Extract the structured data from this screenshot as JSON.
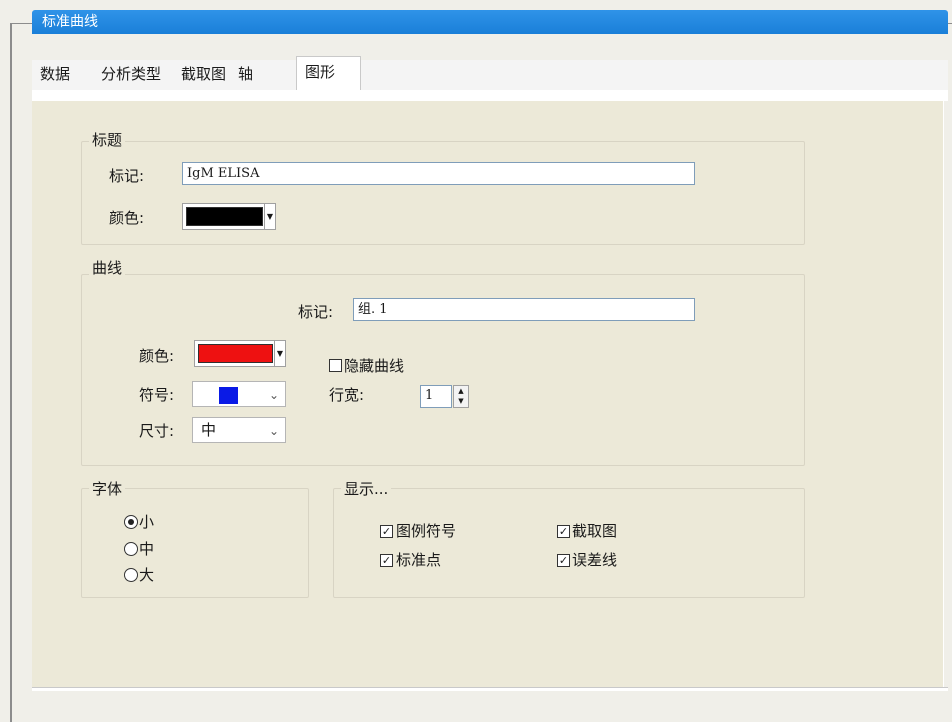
{
  "window": {
    "title": "标准曲线"
  },
  "tabs": [
    {
      "label": "数据"
    },
    {
      "label": "分析类型"
    },
    {
      "label": "截取图"
    },
    {
      "label": "轴"
    },
    {
      "label": "图形",
      "active": true
    }
  ],
  "title_group": {
    "heading": "标题",
    "label_text": "标记:",
    "label_value": "IgM ELISA",
    "color_text": "颜色:",
    "color_value": "#000000"
  },
  "curve_group": {
    "heading": "曲线",
    "label_text": "标记:",
    "label_value": "组. 1",
    "color_text": "颜色:",
    "color_value": "#ee1111",
    "symbol_text": "符号:",
    "symbol_color": "#0a1ae6",
    "size_text": "尺寸:",
    "size_value": "中",
    "hide_curve_label": "隐藏曲线",
    "hide_curve_checked": false,
    "line_width_text": "行宽:",
    "line_width_value": "1"
  },
  "font_group": {
    "heading": "字体",
    "options": [
      {
        "label": "小",
        "selected": true
      },
      {
        "label": "中",
        "selected": false
      },
      {
        "label": "大",
        "selected": false
      }
    ]
  },
  "display_group": {
    "heading": "显示...",
    "items": [
      {
        "label": "图例符号",
        "checked": true
      },
      {
        "label": "截取图",
        "checked": true
      },
      {
        "label": "标准点",
        "checked": true
      },
      {
        "label": "误差线",
        "checked": true
      }
    ]
  }
}
